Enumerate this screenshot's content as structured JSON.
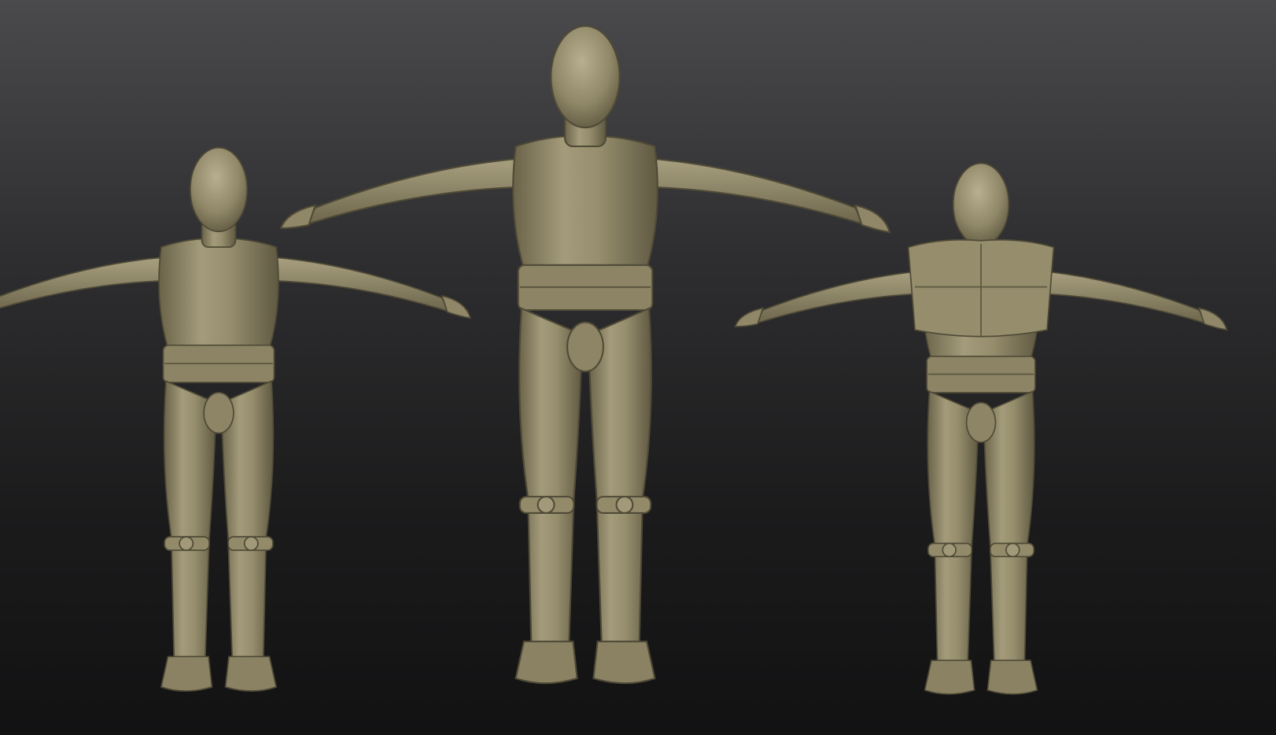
{
  "scene": {
    "background_top": "#4a4a4c",
    "background_bottom": "#121213",
    "clay_color": "#8f8767",
    "clay_highlight": "#b3ab8a",
    "clay_shadow": "#5c5640",
    "figures": [
      {
        "id": "figure-left",
        "pose": "t-pose",
        "view": "three-quarter",
        "armor": false
      },
      {
        "id": "figure-center",
        "pose": "t-pose",
        "view": "front",
        "armor": false
      },
      {
        "id": "figure-right",
        "pose": "t-pose",
        "view": "three-quarter",
        "armor": true
      }
    ]
  }
}
